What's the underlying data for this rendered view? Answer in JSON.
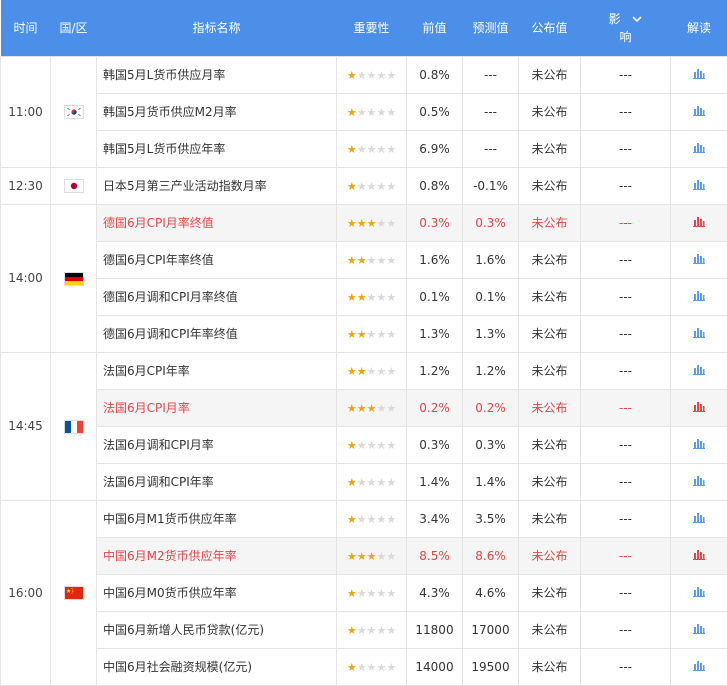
{
  "header": {
    "time": "时间",
    "region": "国/区",
    "indicator": "指标名称",
    "importance": "重要性",
    "previous": "前值",
    "forecast": "预测值",
    "actual": "公布值",
    "impact_line1": "影",
    "impact_line2": "响",
    "analysis": "解读"
  },
  "colors": {
    "header_bg": "#4b8fe8",
    "highlight_text": "#e64545",
    "star_on": "#f0a30a",
    "star_off": "#d9d9d9",
    "chart_normal": "#5b9bef",
    "chart_highlight": "#e64545"
  },
  "groups": [
    {
      "time": "11:00",
      "flag": "kr-flag-icon",
      "events": [
        {
          "name": "韩国5月L货币供应月率",
          "stars": 1,
          "previous": "0.8%",
          "forecast": "---",
          "actual": "未公布",
          "impact": "---",
          "highlight": false
        },
        {
          "name": "韩国5月货币供应M2月率",
          "stars": 1,
          "previous": "0.5%",
          "forecast": "---",
          "actual": "未公布",
          "impact": "---",
          "highlight": false
        },
        {
          "name": "韩国5月L货币供应年率",
          "stars": 1,
          "previous": "6.9%",
          "forecast": "---",
          "actual": "未公布",
          "impact": "---",
          "highlight": false
        }
      ]
    },
    {
      "time": "12:30",
      "flag": "jp-flag-icon",
      "events": [
        {
          "name": "日本5月第三产业活动指数月率",
          "stars": 1,
          "previous": "0.8%",
          "forecast": "-0.1%",
          "actual": "未公布",
          "impact": "---",
          "highlight": false
        }
      ]
    },
    {
      "time": "14:00",
      "flag": "de-flag-icon",
      "events": [
        {
          "name": "德国6月CPI月率终值",
          "stars": 3,
          "previous": "0.3%",
          "forecast": "0.3%",
          "actual": "未公布",
          "impact": "---",
          "highlight": true
        },
        {
          "name": "德国6月CPI年率终值",
          "stars": 2,
          "previous": "1.6%",
          "forecast": "1.6%",
          "actual": "未公布",
          "impact": "---",
          "highlight": false
        },
        {
          "name": "德国6月调和CPI月率终值",
          "stars": 2,
          "previous": "0.1%",
          "forecast": "0.1%",
          "actual": "未公布",
          "impact": "---",
          "highlight": false
        },
        {
          "name": "德国6月调和CPI年率终值",
          "stars": 2,
          "previous": "1.3%",
          "forecast": "1.3%",
          "actual": "未公布",
          "impact": "---",
          "highlight": false
        }
      ]
    },
    {
      "time": "14:45",
      "flag": "fr-flag-icon",
      "events": [
        {
          "name": "法国6月CPI年率",
          "stars": 2,
          "previous": "1.2%",
          "forecast": "1.2%",
          "actual": "未公布",
          "impact": "---",
          "highlight": false
        },
        {
          "name": "法国6月CPI月率",
          "stars": 3,
          "previous": "0.2%",
          "forecast": "0.2%",
          "actual": "未公布",
          "impact": "---",
          "highlight": true
        },
        {
          "name": "法国6月调和CPI月率",
          "stars": 1,
          "previous": "0.3%",
          "forecast": "0.3%",
          "actual": "未公布",
          "impact": "---",
          "highlight": false
        },
        {
          "name": "法国6月调和CPI年率",
          "stars": 1,
          "previous": "1.4%",
          "forecast": "1.4%",
          "actual": "未公布",
          "impact": "---",
          "highlight": false
        }
      ]
    },
    {
      "time": "16:00",
      "flag": "cn-flag-icon",
      "events": [
        {
          "name": "中国6月M1货币供应年率",
          "stars": 1,
          "previous": "3.4%",
          "forecast": "3.5%",
          "actual": "未公布",
          "impact": "---",
          "highlight": false
        },
        {
          "name": "中国6月M2货币供应年率",
          "stars": 3,
          "previous": "8.5%",
          "forecast": "8.6%",
          "actual": "未公布",
          "impact": "---",
          "highlight": true
        },
        {
          "name": "中国6月M0货币供应年率",
          "stars": 1,
          "previous": "4.3%",
          "forecast": "4.6%",
          "actual": "未公布",
          "impact": "---",
          "highlight": false
        },
        {
          "name": "中国6月新增人民币贷款(亿元)",
          "stars": 1,
          "previous": "11800",
          "forecast": "17000",
          "actual": "未公布",
          "impact": "---",
          "highlight": false
        },
        {
          "name": "中国6月社会融资规模(亿元)",
          "stars": 1,
          "previous": "14000",
          "forecast": "19500",
          "actual": "未公布",
          "impact": "---",
          "highlight": false
        }
      ]
    }
  ]
}
